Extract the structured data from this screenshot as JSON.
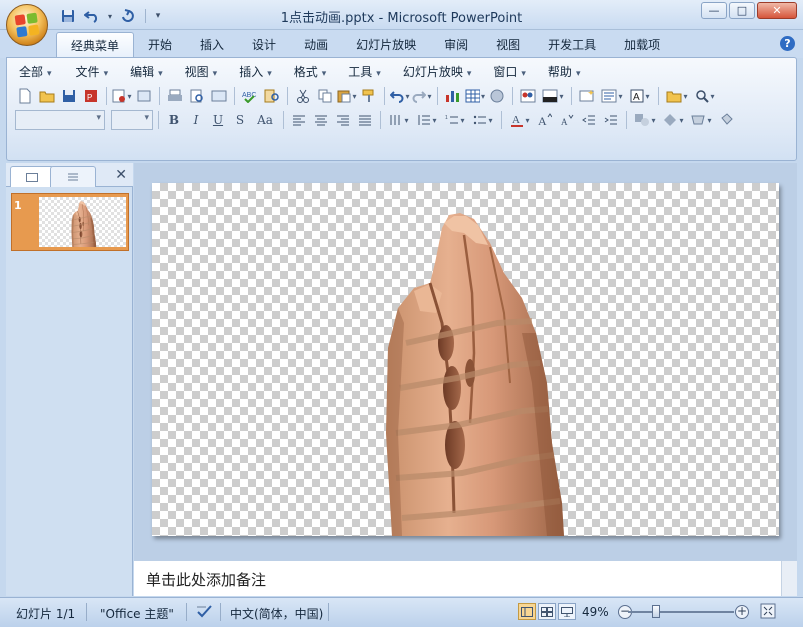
{
  "window": {
    "title": "1点击动画.pptx - Microsoft PowerPoint",
    "minimize": "—",
    "maximize": "□",
    "close": "✕"
  },
  "ribbon_tabs": [
    "经典菜单",
    "开始",
    "插入",
    "设计",
    "动画",
    "幻灯片放映",
    "审阅",
    "视图",
    "开发工具",
    "加载项"
  ],
  "active_tab": "经典菜单",
  "menus": [
    "全部",
    "文件",
    "编辑",
    "视图",
    "插入",
    "格式",
    "工具",
    "幻灯片放映",
    "窗口",
    "帮助"
  ],
  "slides_pane": {
    "slide_number": "1"
  },
  "notes": {
    "placeholder": "单击此处添加备注"
  },
  "status": {
    "slide_info": "幻灯片 1/1",
    "theme": "\"Office 主题\"",
    "language": "中文(简体，中国)",
    "zoom": "49%",
    "zoom_level": 0.49
  },
  "colors": {
    "accent": "#e79a4f",
    "titlebar": "#c9dbf1",
    "slide_bg": "#ffffff"
  }
}
